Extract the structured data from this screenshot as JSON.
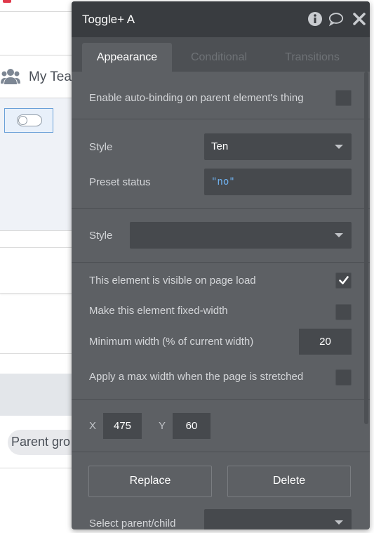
{
  "background": {
    "team_label": "My Tea",
    "parent_group_label": "Parent gro"
  },
  "panel": {
    "title": "Toggle+ A",
    "header_icons": [
      "info-icon",
      "comment-icon",
      "close-icon"
    ],
    "tabs": [
      {
        "label": "Appearance",
        "active": true
      },
      {
        "label": "Conditional",
        "active": false
      },
      {
        "label": "Transitions",
        "active": false
      }
    ],
    "auto_binding": {
      "label": "Enable auto-binding on parent element's thing",
      "checked": false
    },
    "style1": {
      "label": "Style",
      "value": "Ten"
    },
    "preset_status": {
      "label": "Preset status",
      "value": "\"no\""
    },
    "style2": {
      "label": "Style",
      "value": ""
    },
    "visible_on_load": {
      "label": "This element is visible on page load",
      "checked": true
    },
    "fixed_width": {
      "label": "Make this element fixed-width",
      "checked": false
    },
    "min_width": {
      "label": "Minimum width (% of current width)",
      "value": "20"
    },
    "max_width": {
      "label": "Apply a max width when the page is stretched",
      "checked": false
    },
    "position": {
      "x_label": "X",
      "x_value": "475",
      "y_label": "Y",
      "y_value": "60"
    },
    "buttons": {
      "replace": "Replace",
      "delete": "Delete"
    },
    "select_parent": {
      "label": "Select parent/child"
    }
  },
  "colors": {
    "panel_bg": "#5d6064",
    "header_bg": "#393c40",
    "field_bg": "#46494d",
    "string_value": "#6fb1ef",
    "selection_outline": "#6aa0d8"
  }
}
